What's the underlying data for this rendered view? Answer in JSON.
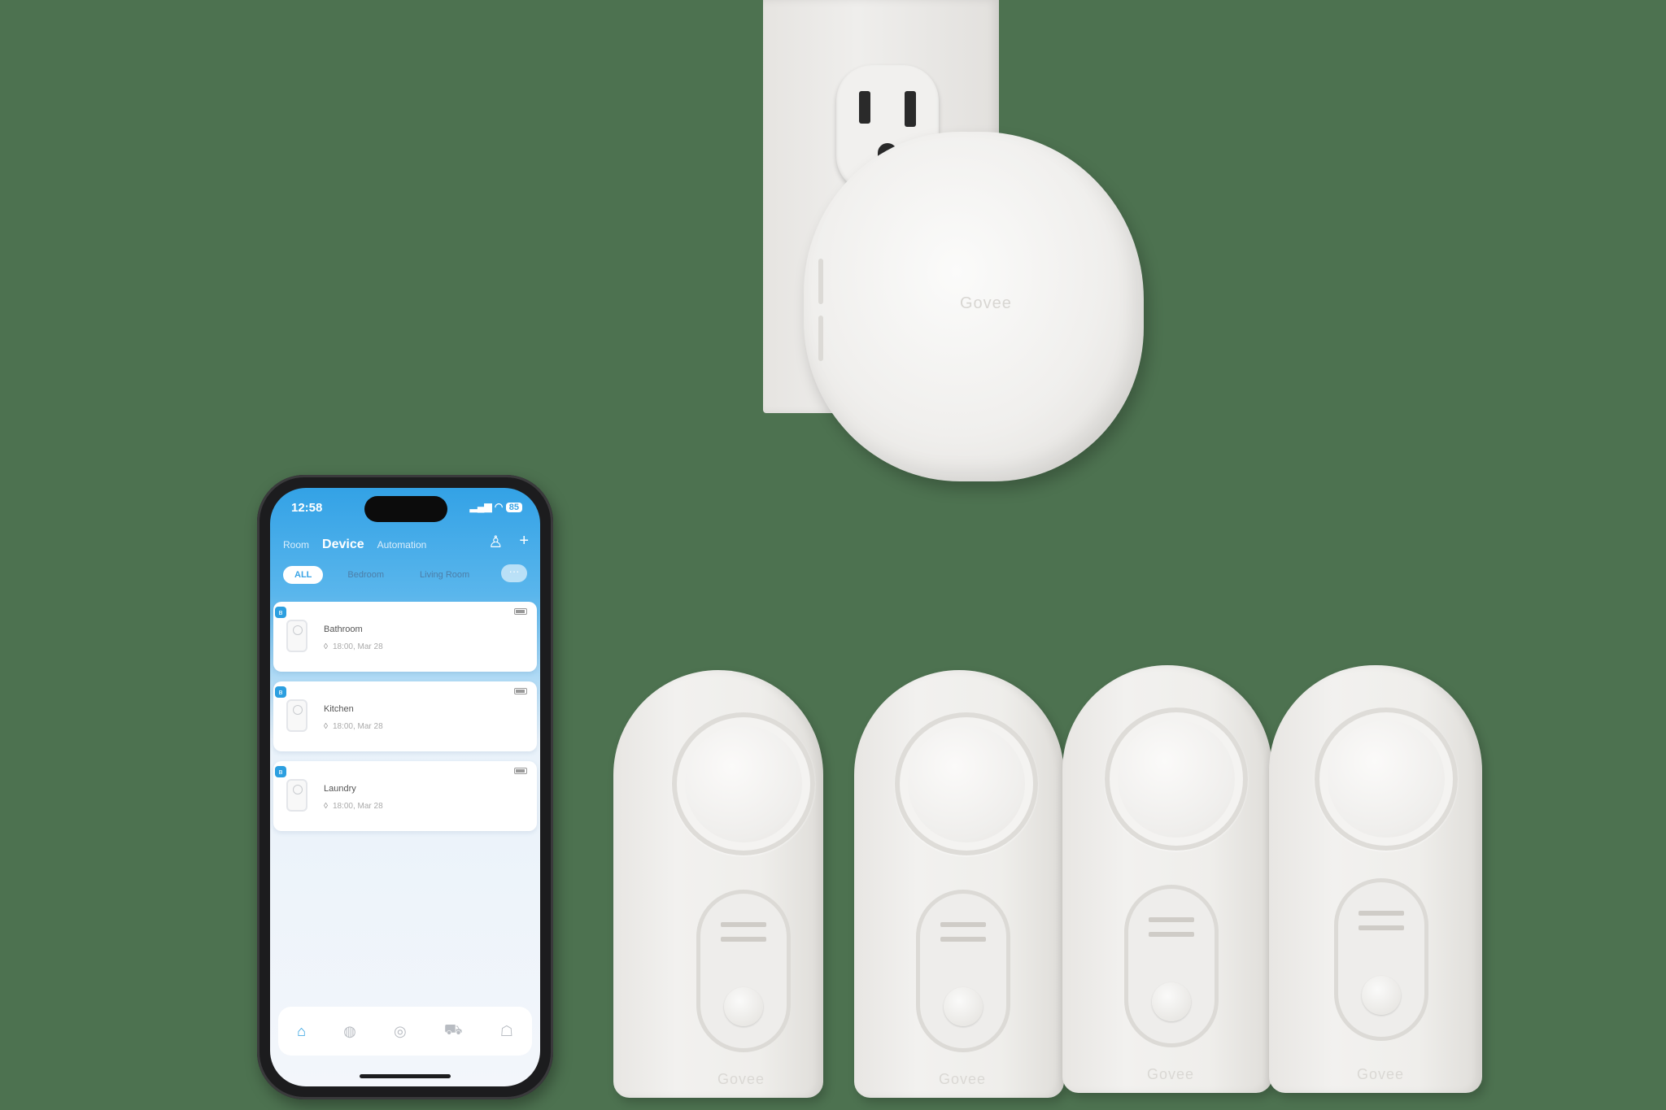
{
  "hub": {
    "logo_text": "Govee"
  },
  "phone": {
    "status": {
      "time": "12:58",
      "network_icons": "▂▄▆ ◠",
      "battery": "85"
    },
    "header_tabs": [
      {
        "label": "Room"
      },
      {
        "label": "Device"
      },
      {
        "label": "Automation"
      }
    ],
    "header_actions": {
      "profile_icon": "user-icon",
      "add_label": "+"
    },
    "filter_chips": [
      {
        "label": "ALL"
      },
      {
        "label": "Bedroom"
      },
      {
        "label": "Living Room"
      }
    ],
    "more_label": "···",
    "devices": [
      {
        "name": "Bathroom",
        "time": "18:00, Mar 28"
      },
      {
        "name": "Kitchen",
        "time": "18:00, Mar 28"
      },
      {
        "name": "Laundry",
        "time": "18:00, Mar 28"
      }
    ],
    "bottom_nav": [
      {
        "icon": "home-icon",
        "glyph": "⌂"
      },
      {
        "icon": "globe-icon",
        "glyph": "◍"
      },
      {
        "icon": "compass-icon",
        "glyph": "◎"
      },
      {
        "icon": "cart-icon",
        "glyph": "⛟"
      },
      {
        "icon": "store-icon",
        "glyph": "☖"
      }
    ]
  },
  "sensors": [
    {
      "logo_text": "Govee"
    },
    {
      "logo_text": "Govee"
    },
    {
      "logo_text": "Govee"
    },
    {
      "logo_text": "Govee"
    }
  ],
  "colors": {
    "background": "#4d7250",
    "app_accent": "#2c9fe0",
    "device_body": "#efeeec"
  }
}
